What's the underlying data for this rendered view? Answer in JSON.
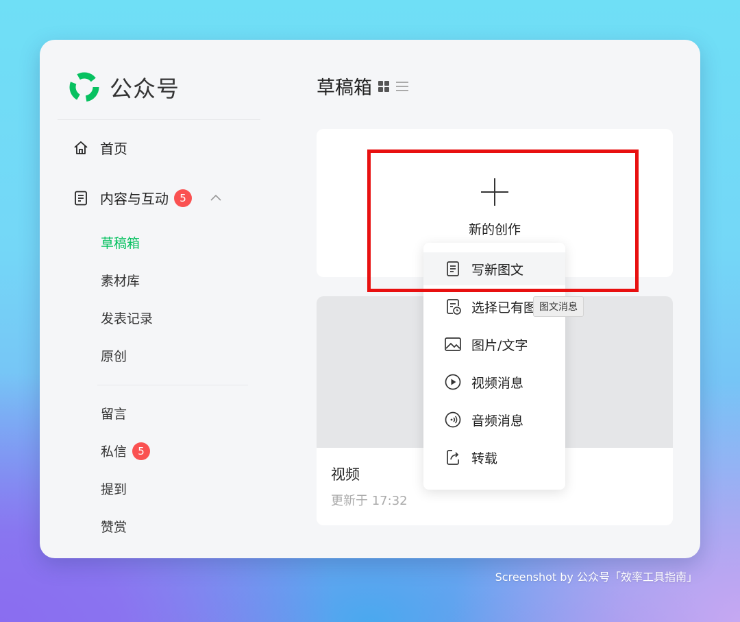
{
  "app": {
    "title": "公众号"
  },
  "sidebar": {
    "home": "首页",
    "content_section": {
      "label": "内容与互动",
      "badge": "5"
    },
    "content_items": [
      "草稿箱",
      "素材库",
      "发表记录",
      "原创"
    ],
    "interaction_items": [
      {
        "label": "留言",
        "badge": ""
      },
      {
        "label": "私信",
        "badge": "5"
      },
      {
        "label": "提到",
        "badge": ""
      },
      {
        "label": "赞赏",
        "badge": ""
      }
    ]
  },
  "main": {
    "title": "草稿箱",
    "new_creation": "新的创作",
    "draft": {
      "title": "视频",
      "updated": "更新于 17:32"
    }
  },
  "menu": {
    "items": [
      "写新图文",
      "选择已有图",
      "图片/文字",
      "视频消息",
      "音频消息",
      "转载"
    ]
  },
  "tooltip": "图文消息",
  "credit": "Screenshot by 公众号「效率工具指南」",
  "colors": {
    "accent": "#07c160",
    "badge": "#fa5151",
    "highlight": "#e81010"
  }
}
